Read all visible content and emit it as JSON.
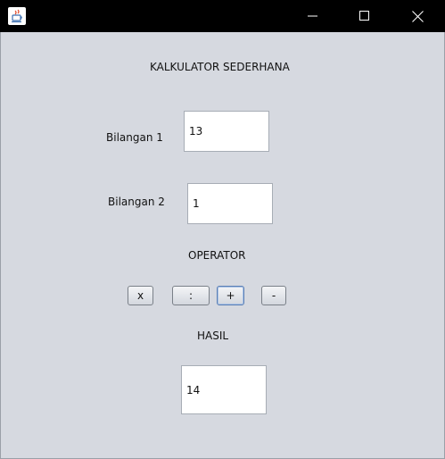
{
  "title": "KALKULATOR SEDERHANA",
  "field1": {
    "label": "Bilangan 1",
    "value": "13"
  },
  "field2": {
    "label": "Bilangan 2",
    "value": "1"
  },
  "operator": {
    "label": "OPERATOR",
    "buttons": [
      "x",
      ":",
      "+",
      "-"
    ]
  },
  "result": {
    "label": "HASIL",
    "value": "14"
  },
  "icons": {
    "app": "java-cup-icon",
    "minimize": "minimize-icon",
    "maximize": "maximize-icon",
    "close": "close-icon"
  }
}
